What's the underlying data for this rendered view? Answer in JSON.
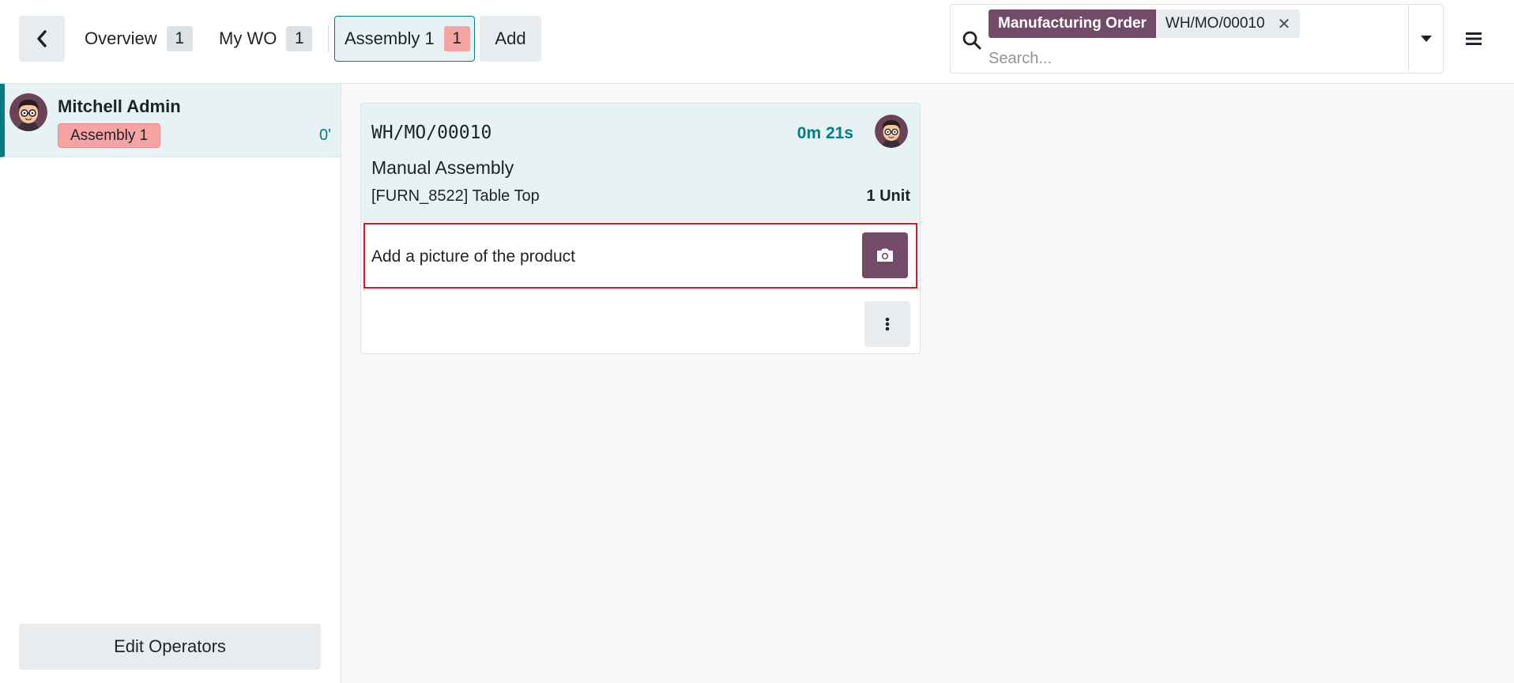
{
  "topbar": {
    "back_icon": "chevron-left-icon",
    "nav": [
      {
        "label": "Overview",
        "count": "1"
      },
      {
        "label": "My WO",
        "count": "1"
      }
    ],
    "active_tab": {
      "label": "Assembly 1",
      "count": "1"
    },
    "add_label": "Add",
    "menu_icon": "hamburger-menu-icon"
  },
  "search": {
    "icon": "search-icon",
    "facet": {
      "label": "Manufacturing Order",
      "value": "WH/MO/00010"
    },
    "remove_icon": "close-icon",
    "placeholder": "Search...",
    "toggle_icon": "caret-down-icon"
  },
  "sidebar": {
    "operators": [
      {
        "name": "Mitchell Admin",
        "workcenter": "Assembly 1",
        "time": "0'"
      }
    ],
    "edit_operators_label": "Edit Operators"
  },
  "workorder": {
    "name": "WH/MO/00010",
    "timer": "0m 21s",
    "operation": "Manual Assembly",
    "product": "[FURN_8522] Table Top",
    "quantity": "1 Unit",
    "step": {
      "label": "Add a picture of the product",
      "icon": "camera-icon"
    },
    "more_icon": "vertical-ellipsis-icon"
  },
  "colors": {
    "brand": "#714b67",
    "accent": "#017e84",
    "danger_badge": "#f6a3a3",
    "highlight_border": "#e4141c"
  }
}
